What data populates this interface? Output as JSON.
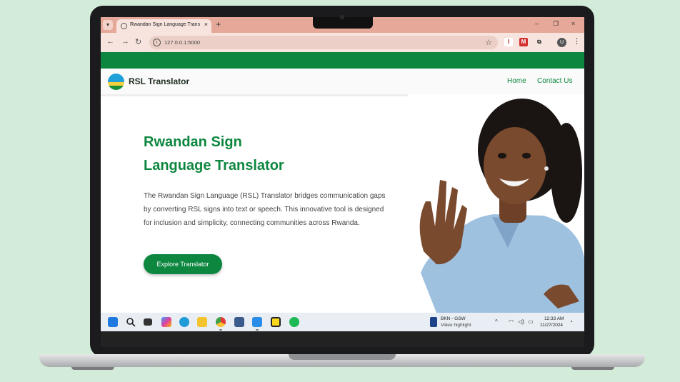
{
  "browser": {
    "tab_menu_icon": "chevron-down-icon",
    "tab_title": "Rwandan Sign Language Translator",
    "tab_close": "×",
    "new_tab": "+",
    "window_controls": {
      "minimize": "–",
      "restore": "❐",
      "close": "×"
    },
    "url": "127.0.0.1:5000",
    "nav": {
      "back": "←",
      "forward": "→",
      "reload": "↻"
    },
    "bookmark": "☆",
    "extensions": [
      {
        "label": "I",
        "color": "#ffffff",
        "fg": "#c62828"
      },
      {
        "label": "M",
        "color": "#d32f2f",
        "fg": "#ffffff"
      },
      {
        "label": "⧉",
        "color": "#f7e4de",
        "fg": "#333333"
      }
    ],
    "profile_initial": "U",
    "menu": "⋮"
  },
  "site": {
    "brand": "RSL Translator",
    "nav_links": [
      "Home",
      "Contact Us"
    ],
    "hero_title_line1": "Rwandan Sign",
    "hero_title_line2": "Language Translator",
    "hero_text": "The Rwandan Sign Language (RSL) Translator bridges communication gaps by converting RSL signs into text or speech. This innovative tool is designed for inclusion and simplicity, connecting communities across Rwanda.",
    "cta": "Explore Translator",
    "colors": {
      "brand_green": "#0d873f",
      "flag_blue": "#20a0d8",
      "flag_yellow": "#f4d03f",
      "flag_green": "#1a8f3a"
    }
  },
  "taskbar": {
    "apps": [
      "start-icon",
      "search-icon",
      "task-view-icon",
      "copilot-icon",
      "edge-icon",
      "file-explorer-icon",
      "chrome-icon",
      "app-icon",
      "vscode-icon",
      "sticky-notes-icon",
      "spotify-icon"
    ],
    "news_title": "BKN - GSW",
    "news_subtitle": "Video highlight",
    "tray_chevron": "^",
    "time": "12:33 AM",
    "date": "11/27/2024",
    "bell": "🔔"
  }
}
